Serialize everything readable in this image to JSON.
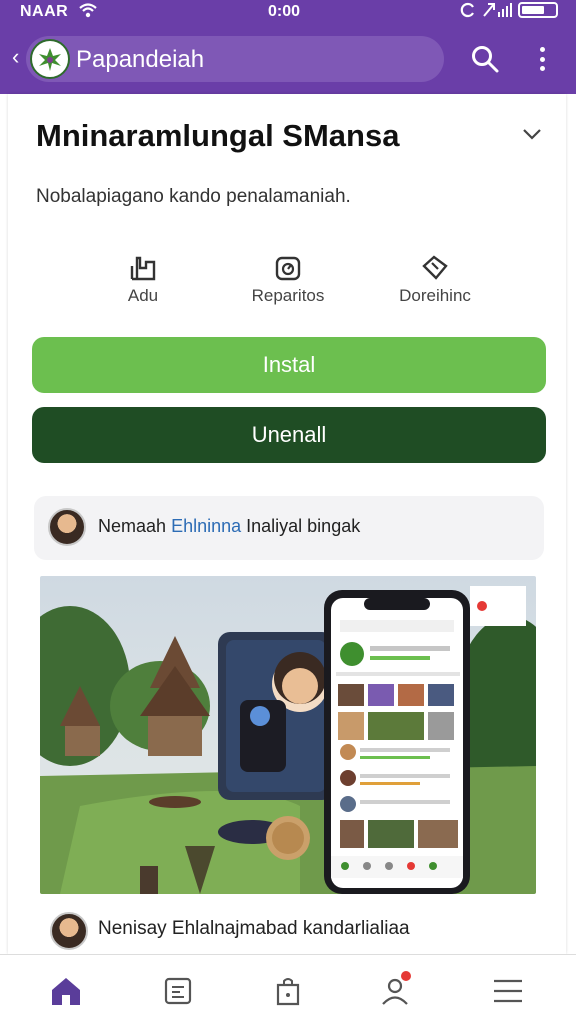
{
  "status_bar": {
    "carrier": "NAAR",
    "time": "0:00"
  },
  "app_bar": {
    "title": "Papandeiah"
  },
  "app": {
    "name": "Mninaramlungal SMansa",
    "description": "Nobalapiagano kando penalamaniah."
  },
  "actions": [
    {
      "label": "Adu",
      "icon": "add-icon"
    },
    {
      "label": "Reparitos",
      "icon": "report-icon"
    },
    {
      "label": "Doreihinc",
      "icon": "tag-icon"
    }
  ],
  "buttons": {
    "install": "Instal",
    "uninstall": "Unenall"
  },
  "reviewer": {
    "name": "Nemaah",
    "link": "Ehlninna",
    "rest": "Inaliyal bingak"
  },
  "comment": {
    "text": "Nenisay Ehlalnajmabad kandarlialiaa"
  },
  "colors": {
    "accent": "#6a3ea8",
    "install": "#6cbf4f",
    "uninstall": "#1f4d24"
  }
}
